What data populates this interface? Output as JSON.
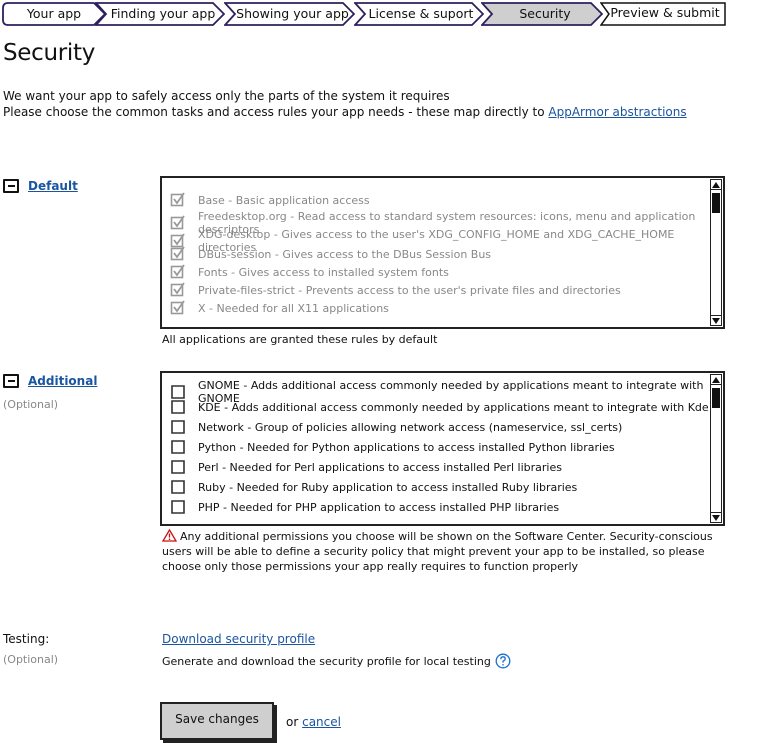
{
  "wizard": {
    "steps": [
      {
        "label": "Your app",
        "state": "done"
      },
      {
        "label": "Finding your app",
        "state": "done"
      },
      {
        "label": "Showing your app",
        "state": "done"
      },
      {
        "label": "License & suport",
        "state": "done"
      },
      {
        "label": "Security",
        "state": "current"
      },
      {
        "label": "Preview & submit",
        "state": "todo"
      }
    ]
  },
  "page": {
    "title": "Security",
    "intro_line1": "We want your app to safely access only the parts of the system it requires",
    "intro_line2": "Please choose the common tasks and access rules your app needs - these map directly to ",
    "intro_link": "AppArmor abstractions"
  },
  "default_section": {
    "label": "Default",
    "collapse_symbol": "−",
    "rules": [
      {
        "label": "Base - Basic application access",
        "checked": true
      },
      {
        "label": "Freedesktop.org - Read access to standard system resources: icons, menu and application descriptors",
        "checked": true
      },
      {
        "label": "XDG-desktop - Gives access to the user's XDG_CONFIG_HOME and XDG_CACHE_HOME directories",
        "checked": true
      },
      {
        "label": "DBus-session - Gives access to the DBus Session Bus",
        "checked": true
      },
      {
        "label": "Fonts - Gives access to installed system fonts",
        "checked": true
      },
      {
        "label": "Private-files-strict - Prevents access to the user's private files and directories",
        "checked": true
      },
      {
        "label": "X - Needed for all X11 applications",
        "checked": true
      }
    ],
    "caption": "All applications are granted these rules by default"
  },
  "additional_section": {
    "label": "Additional",
    "optional": "(Optional)",
    "rules": [
      {
        "label": "GNOME - Adds additional access commonly needed by applications meant to integrate with GNOME",
        "checked": false
      },
      {
        "label": "KDE - Adds additional access commonly needed by applications meant to integrate with Kde",
        "checked": false
      },
      {
        "label": "Network - Group of policies allowing network access (nameservice, ssl_certs)",
        "checked": false
      },
      {
        "label": "Python - Needed for Python applications to access installed Python libraries",
        "checked": false
      },
      {
        "label": "Perl - Needed for Perl applications to access installed Perl libraries",
        "checked": false
      },
      {
        "label": "Ruby - Needed for Ruby application to access installed Ruby libraries",
        "checked": false
      },
      {
        "label": "PHP - Needed for PHP application to access installed PHP libraries",
        "checked": false
      }
    ],
    "warning": "Any additional permissions you choose will be shown on the Software Center. Security-conscious users will be able to define a security policy that might prevent your app to be installed, so please choose only those permissions your app really requires to function properly"
  },
  "testing": {
    "label": "Testing:",
    "optional": "(Optional)",
    "download_link": "Download security profile",
    "description": "Generate and download the security profile for local testing"
  },
  "actions": {
    "save_label": "Save changes",
    "or_text": "or ",
    "cancel_label": "cancel"
  },
  "colors": {
    "link": "#1a55a0",
    "step_border": "#2e1f5e",
    "current_step_fill": "#cfcfcf",
    "warning": "#cc1111",
    "help": "#1a6fd0"
  }
}
